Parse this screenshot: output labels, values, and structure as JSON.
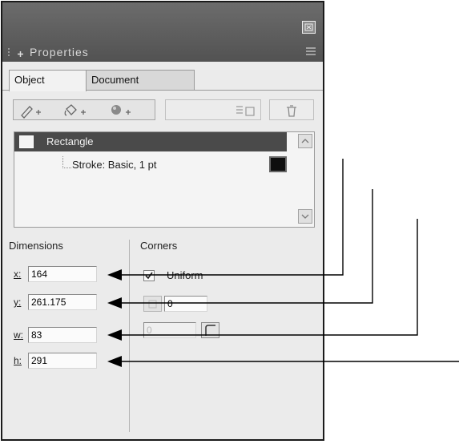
{
  "panel": {
    "title": "Properties",
    "tabs": [
      {
        "label": "Object",
        "active": true
      },
      {
        "label": "Document",
        "active": false
      }
    ],
    "icons": {
      "close": "close-icon",
      "options": "options-menu-icon"
    }
  },
  "toolbar": {
    "buttons": [
      "add-stroke",
      "add-fill",
      "add-effect",
      "duplicate-attribute",
      "delete-attribute"
    ]
  },
  "attributes": {
    "selected_object": "Rectangle",
    "stroke": "Stroke: Basic, 1 pt",
    "stroke_color": "#0e0e0e"
  },
  "dimensions": {
    "title": "Dimensions",
    "fields": [
      {
        "label": "x:",
        "value": "164"
      },
      {
        "label": "y:",
        "value": "261.175"
      },
      {
        "label": "w:",
        "value": "83"
      },
      {
        "label": "h:",
        "value": "291"
      }
    ]
  },
  "corners": {
    "title": "Corners",
    "uniform_label": "Uniform",
    "uniform_checked": true,
    "radius_value": "0",
    "secondary_value": "0"
  },
  "colors": {
    "titlebar": "#5c5c5c",
    "selected_row": "#4a4a4a",
    "panel_bg": "#ebebeb"
  }
}
